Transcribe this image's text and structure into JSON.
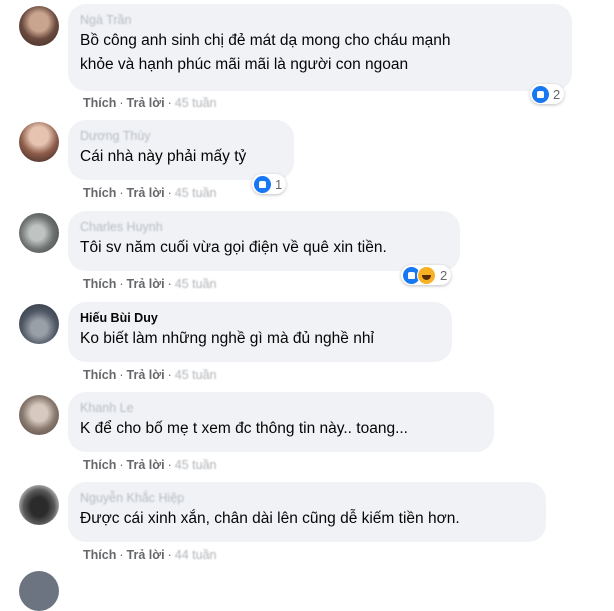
{
  "actions": {
    "like_label": "Thích",
    "reply_label": "Trả lời",
    "sep": "·"
  },
  "comments": [
    {
      "author": "Ngà Trần",
      "text": [
        "Bồ công anh sinh chị đẻ mát dạ mong cho cháu mạnh",
        "khỏe và hạnh phúc mãi mãi là người con ngoan"
      ],
      "time": "45 tuần",
      "reactions": [
        "like-icon"
      ],
      "reaction_count": "2"
    },
    {
      "author": "Dương Thùy",
      "text": [
        "Cái nhà này phải mấy tỷ"
      ],
      "time": "45 tuần",
      "reactions": [
        "like-icon"
      ],
      "reaction_count": "1"
    },
    {
      "author": "Charles Huynh",
      "text": [
        "Tôi sv năm cuối vừa gọi điện về quê xin tiền."
      ],
      "time": "45 tuần",
      "reactions": [
        "like-icon",
        "haha-icon"
      ],
      "reaction_count": "2"
    },
    {
      "author": "Hiếu Bùi Duy",
      "text": [
        "Ko biết làm những nghề gì mà đủ nghề nhỉ"
      ],
      "time": "45 tuần"
    },
    {
      "author": "Khanh Le",
      "text": [
        "K để cho bố mẹ t xem đc thông tin này.. toang..."
      ],
      "time": "45 tuần"
    },
    {
      "author": "Nguyễn Khắc Hiệp",
      "text": [
        "Được cái xinh xắn, chân dài lên cũng dễ kiếm tiền hơn."
      ],
      "time": "44 tuần"
    }
  ],
  "colors": {
    "bubble": "#f0f2f5",
    "like_blue": "#1877f2",
    "haha_yellow": "#f7b125",
    "meta_gray": "#65676b"
  }
}
